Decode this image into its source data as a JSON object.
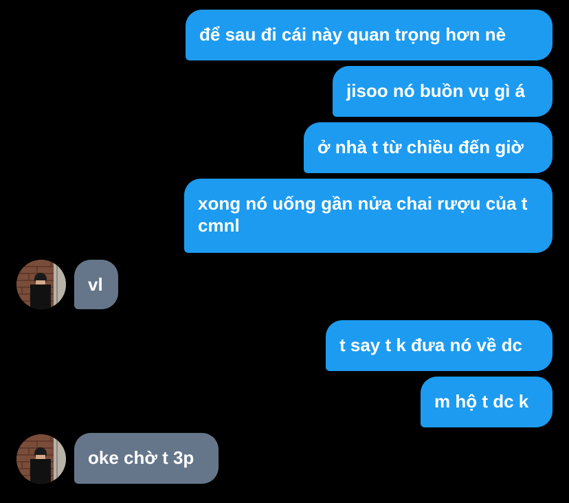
{
  "conversation": {
    "messages": [
      {
        "sender": "me",
        "text": "để sau đi cái này quan trọng hơn nè"
      },
      {
        "sender": "me",
        "text": "jisoo nó buồn vụ gì á"
      },
      {
        "sender": "me",
        "text": "ở nhà t từ chiều đến giờ"
      },
      {
        "sender": "me",
        "text": "xong nó uống gần nửa chai rượu của t cmnl"
      },
      {
        "sender": "other",
        "text": "vl"
      },
      {
        "sender": "me",
        "text": "t say t k đưa nó về dc"
      },
      {
        "sender": "me",
        "text": "m hộ t dc k"
      },
      {
        "sender": "other",
        "text": "oke chờ t 3p"
      }
    ]
  },
  "colors": {
    "background": "#000000",
    "outgoing_bubble": "#1d9bf0",
    "incoming_bubble": "#65768a",
    "text": "#ffffff"
  },
  "icons": {
    "avatar": "user-avatar-photo"
  }
}
